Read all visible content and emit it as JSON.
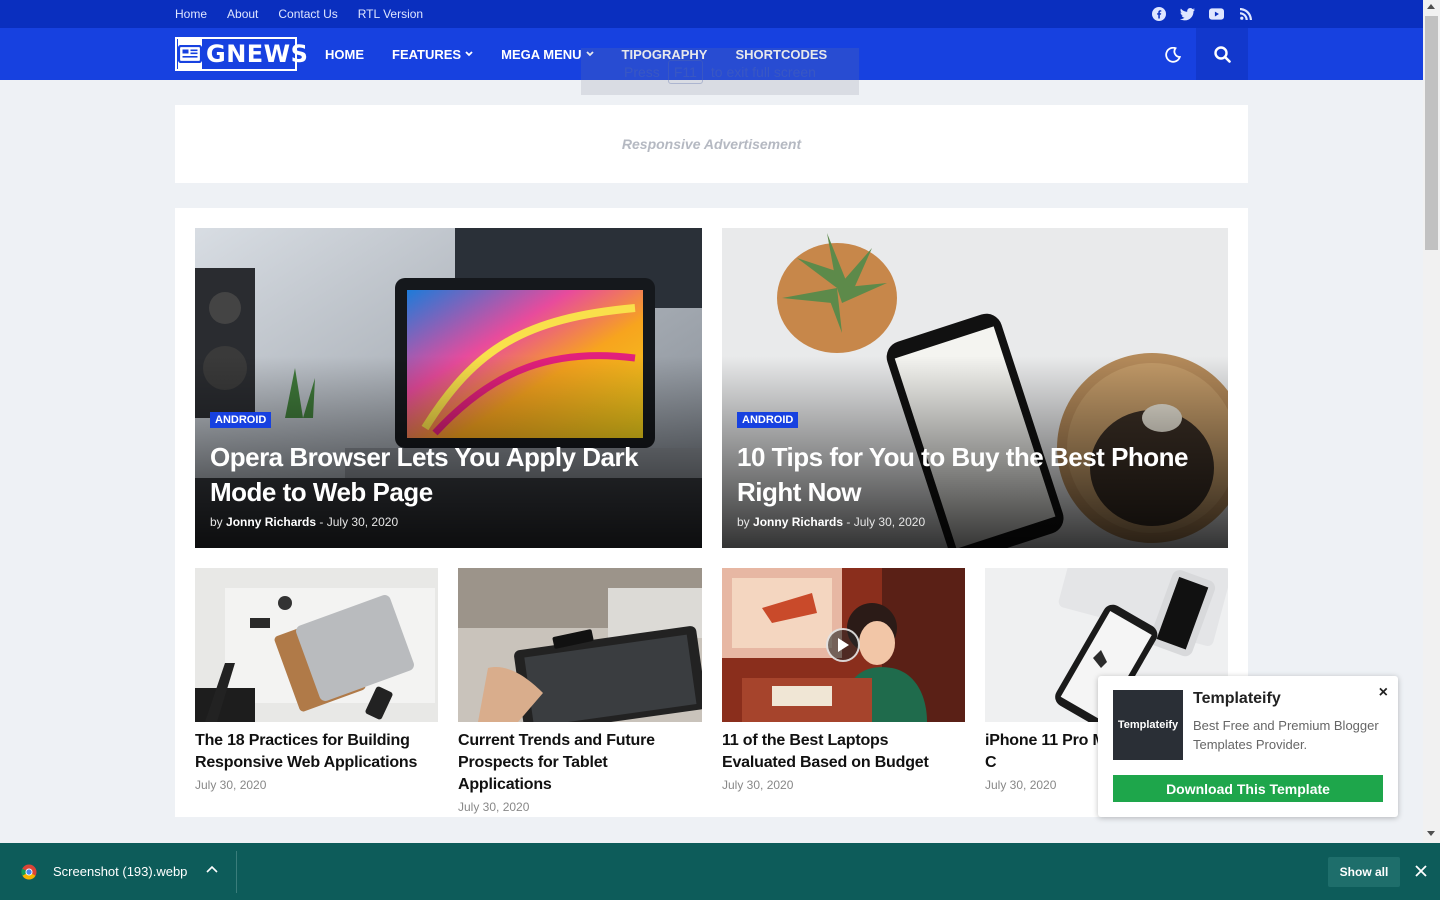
{
  "topbar": {
    "links": [
      "Home",
      "About",
      "Contact Us",
      "RTL Version"
    ],
    "social_icons": [
      "facebook-icon",
      "twitter-icon",
      "youtube-icon",
      "rss-icon"
    ]
  },
  "nav": {
    "logo_text": "GNEWS",
    "menu": [
      {
        "label": "HOME",
        "dropdown": false
      },
      {
        "label": "FEATURES",
        "dropdown": true
      },
      {
        "label": "MEGA MENU",
        "dropdown": true
      },
      {
        "label": "TIPOGRAPHY",
        "dropdown": false
      },
      {
        "label": "SHORTCODES",
        "dropdown": false
      }
    ]
  },
  "fullscreen_toast": {
    "before": "Press",
    "key": "F11",
    "after": "to exit full screen"
  },
  "ad": {
    "label": "Responsive Advertisement"
  },
  "featured": [
    {
      "category": "ANDROID",
      "title": "Opera Browser Lets You Apply Dark Mode to Web Page",
      "by": "by",
      "author": "Jonny Richards",
      "date": "- July 30, 2020"
    },
    {
      "category": "ANDROID",
      "title": "10 Tips for You to Buy the Best Phone Right Now",
      "by": "by",
      "author": "Jonny Richards",
      "date": "- July 30, 2020"
    }
  ],
  "cards": [
    {
      "title": "The 18 Practices for Building Responsive Web Applications",
      "date": "July 30, 2020"
    },
    {
      "title": "Current Trends and Future Prospects for Tablet Applications",
      "date": "July 30, 2020"
    },
    {
      "title": "11 of the Best Laptops Evaluated Based on Budget",
      "date": "July 30, 2020"
    },
    {
      "title": "iPhone 11 Pro M Rated Phone by C",
      "date": "July 30, 2020"
    }
  ],
  "popup": {
    "logo_text": "Templateify",
    "title": "Templateify",
    "description": "Best Free and Premium Blogger Templates Provider.",
    "button": "Download This Template",
    "close": "×"
  },
  "downloads": {
    "filename": "Screenshot (193).webp",
    "show_all": "Show all"
  },
  "colors": {
    "topbar": "#0a2fbf",
    "nav": "#1741e0",
    "badge": "#1741e0",
    "download_button": "#1ea64b",
    "downloads_bar": "#0d5c5a"
  }
}
